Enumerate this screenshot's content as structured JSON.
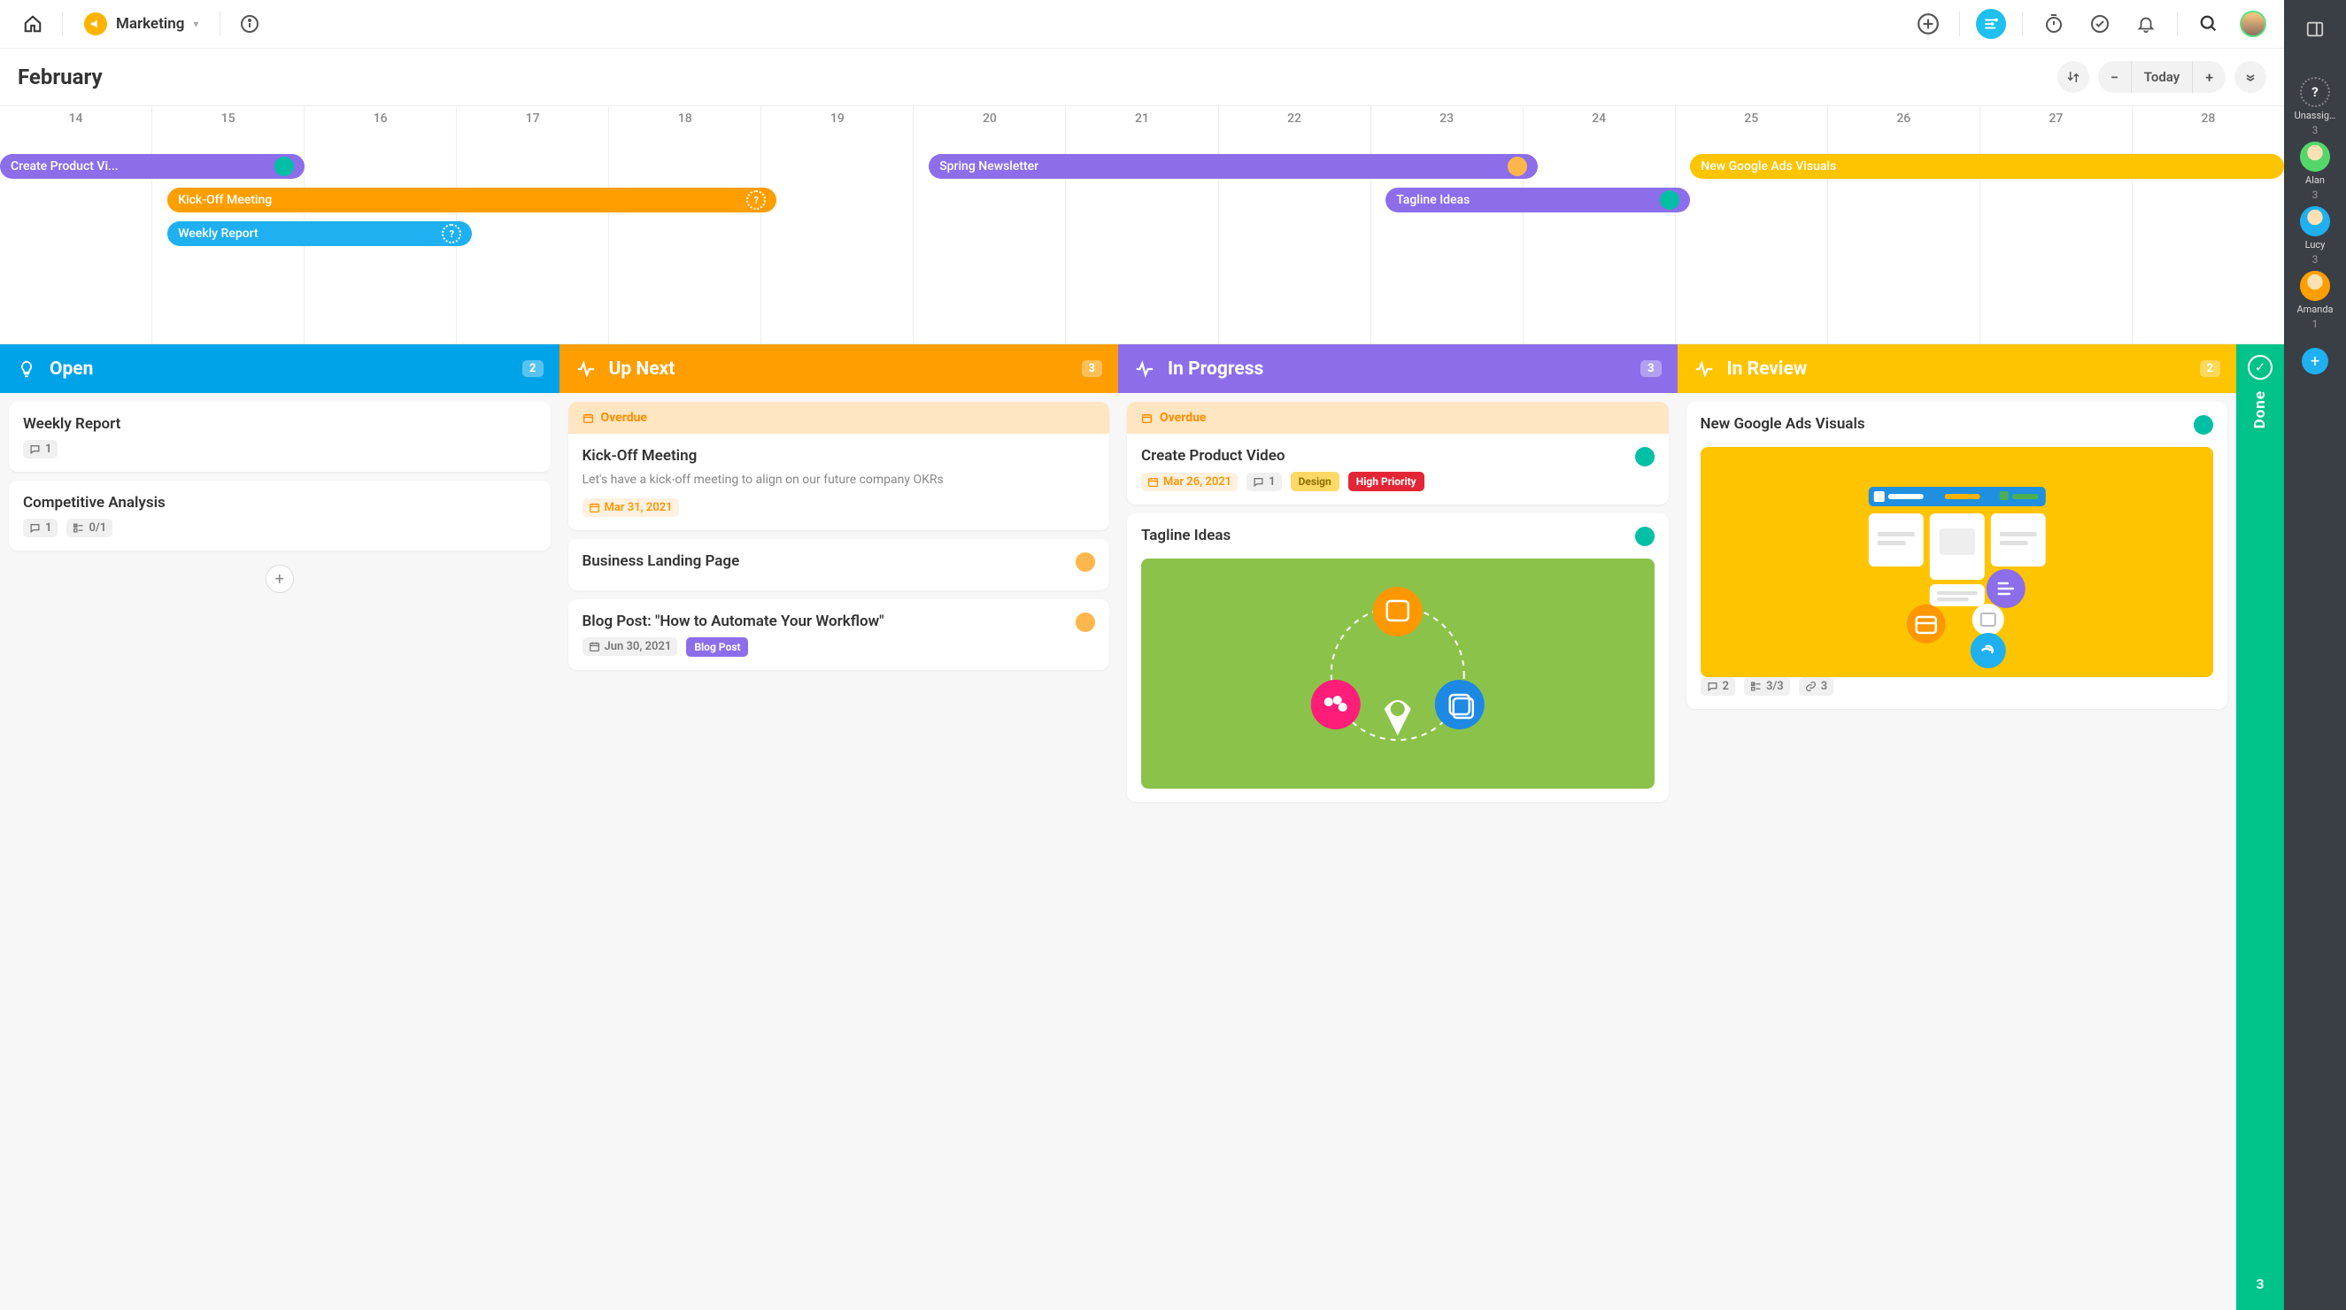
{
  "workspace": {
    "name": "Marketing"
  },
  "calendar": {
    "title": "February",
    "today_label": "Today",
    "days": [
      "14",
      "15",
      "16",
      "17",
      "18",
      "19",
      "20",
      "21",
      "22",
      "23",
      "24",
      "25",
      "26",
      "27",
      "28"
    ],
    "events": [
      {
        "label": "Create Product Vi...",
        "color": "purple",
        "row": 0,
        "start": 0,
        "span": 2.0,
        "avatar": "teal"
      },
      {
        "label": "Spring Newsletter",
        "color": "purple",
        "row": 0,
        "start": 6.1,
        "span": 4.0,
        "avatar": "orange"
      },
      {
        "label": "New Google Ads Visuals",
        "color": "yellow",
        "row": 0,
        "start": 11.1,
        "span": 3.9,
        "avatar": null
      },
      {
        "label": "Kick-Off Meeting",
        "color": "orange",
        "row": 1,
        "start": 1.1,
        "span": 4.0,
        "avatar": "q"
      },
      {
        "label": "Tagline Ideas",
        "color": "purple",
        "row": 1,
        "start": 9.1,
        "span": 2.0,
        "avatar": "teal"
      },
      {
        "label": "Weekly Report",
        "color": "blue",
        "row": 2,
        "start": 1.1,
        "span": 2.0,
        "avatar": "q"
      }
    ]
  },
  "board": {
    "columns": [
      {
        "title": "Open",
        "color": "#00a3e8",
        "count": "2",
        "icon": "lightbulb",
        "cards": [
          {
            "title": "Weekly Report",
            "comments": "1"
          },
          {
            "title": "Competitive Analysis",
            "comments": "1",
            "checklist": "0/1"
          }
        ],
        "show_add": true
      },
      {
        "title": "Up Next",
        "color": "#ff9e00",
        "count": "3",
        "icon": "pulse",
        "cards": [
          {
            "overdue_label": "Overdue",
            "title": "Kick-Off Meeting",
            "desc": "Let's have a kick-off meeting to align on our future company OKRs",
            "date": "Mar 31, 2021",
            "date_style": "orange"
          },
          {
            "title": "Business Landing Page",
            "avatar": "orange"
          },
          {
            "title": "Blog Post: \"How to Automate Your Workflow\"",
            "avatar": "orange",
            "date": "Jun 30, 2021",
            "date_style": "plain",
            "tags": [
              {
                "text": "Blog Post",
                "style": "blog"
              }
            ]
          }
        ]
      },
      {
        "title": "In Progress",
        "color": "#8c6eea",
        "count": "3",
        "icon": "pulse",
        "cards": [
          {
            "overdue_label": "Overdue",
            "title": "Create Product Video",
            "avatar": "teal",
            "date": "Mar 26, 2021",
            "date_style": "orange",
            "comments": "1",
            "tags": [
              {
                "text": "Design",
                "style": "design"
              },
              {
                "text": "High Priority",
                "style": "high"
              }
            ]
          },
          {
            "title": "Tagline Ideas",
            "avatar": "teal",
            "thumb": "green"
          }
        ]
      },
      {
        "title": "In Review",
        "color": "#ffc400",
        "count": "2",
        "icon": "pulse",
        "cards": [
          {
            "title": "New Google Ads Visuals",
            "avatar": "teal",
            "thumb": "yellow",
            "comments": "2",
            "checklist": "3/3",
            "links": "3"
          }
        ]
      }
    ],
    "done": {
      "label": "Done",
      "count": "3"
    }
  },
  "rail": {
    "users": [
      {
        "name": "Unassig…",
        "count": "3",
        "avatar": "q",
        "color": "#555"
      },
      {
        "name": "Alan",
        "count": "3",
        "avatar": "",
        "color": "#54d66b"
      },
      {
        "name": "Lucy",
        "count": "3",
        "avatar": "",
        "color": "#1eb0f0"
      },
      {
        "name": "Amanda",
        "count": "1",
        "avatar": "",
        "color": "#ff9e00"
      }
    ]
  }
}
